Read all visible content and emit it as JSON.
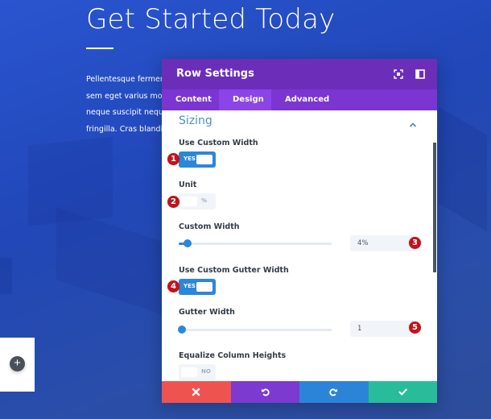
{
  "page": {
    "hero_title": "Get Started Today",
    "hero_text_lines": [
      "Pellentesque ferment",
      "sem eget varius mollis",
      "neque suscipit neque",
      "fringilla. Cras blandit u"
    ],
    "add_button_icon": "plus-icon"
  },
  "modal": {
    "title": "Row Settings",
    "header_icons": [
      "expand-icon",
      "split-view-icon"
    ],
    "tabs": [
      {
        "label": "Content",
        "active": false
      },
      {
        "label": "Design",
        "active": true
      },
      {
        "label": "Advanced",
        "active": false
      }
    ],
    "section": {
      "title": "Sizing",
      "collapse_icon": "chevron-up-icon"
    },
    "fields": {
      "use_custom_width": {
        "label": "Use Custom Width",
        "value": "YES",
        "on": true,
        "badge": "1"
      },
      "unit": {
        "label": "Unit",
        "value": "%",
        "on": false,
        "badge": "2"
      },
      "custom_width": {
        "label": "Custom Width",
        "value": "4%",
        "slider_percent": 6,
        "badge": "3"
      },
      "use_custom_gutter_width": {
        "label": "Use Custom Gutter Width",
        "value": "YES",
        "on": true,
        "badge": "4"
      },
      "gutter_width": {
        "label": "Gutter Width",
        "value": "1",
        "slider_percent": 2,
        "badge": "5"
      },
      "equalize_column_heights": {
        "label": "Equalize Column Heights",
        "value": "NO",
        "on": false
      }
    },
    "footer": {
      "cancel_icon": "close-icon",
      "undo_icon": "undo-icon",
      "redo_icon": "redo-icon",
      "save_icon": "check-icon"
    }
  },
  "colors": {
    "header": "#6c2eb9",
    "tabs": "#7b35d0",
    "tab_active": "#8b44e8",
    "accent": "#2b87da",
    "section_title": "#4f8fbf",
    "cancel": "#ef5350",
    "undo": "#7c3ad0",
    "redo": "#2b84d8",
    "save": "#29bc9b",
    "badge": "#c4121a"
  }
}
